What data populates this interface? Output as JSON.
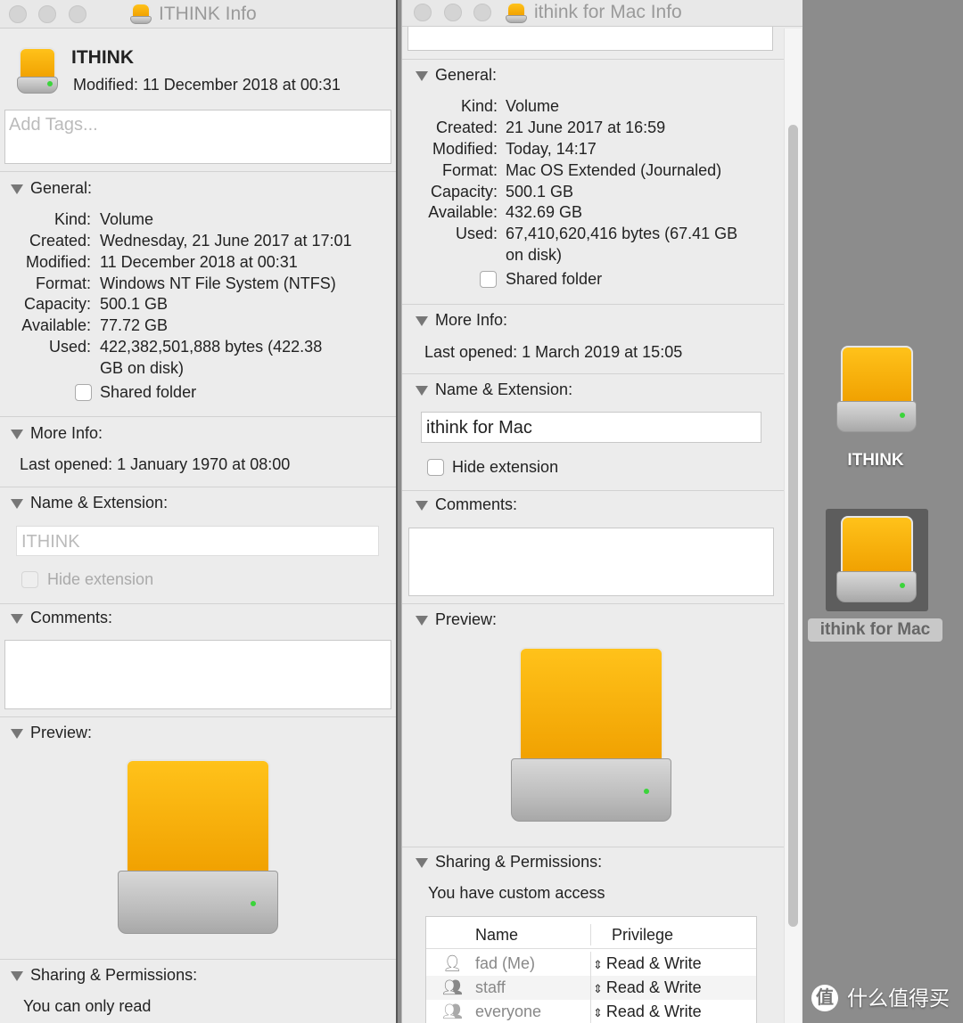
{
  "left": {
    "title": "ITHINK Info",
    "name": "ITHINK",
    "modified": "Modified: 11 December 2018 at 00:31",
    "tags_placeholder": "Add Tags...",
    "general": {
      "heading": "General:",
      "rows": [
        {
          "label": "Kind:",
          "value": "Volume"
        },
        {
          "label": "Created:",
          "value": "Wednesday, 21 June 2017 at 17:01"
        },
        {
          "label": "Modified:",
          "value": "11 December 2018 at 00:31"
        },
        {
          "label": "Format:",
          "value": "Windows NT File System (NTFS)"
        },
        {
          "label": "Capacity:",
          "value": "500.1 GB"
        },
        {
          "label": "Available:",
          "value": "77.72 GB"
        },
        {
          "label": "Used:",
          "value": "422,382,501,888 bytes (422.38",
          "value2": "GB on disk)"
        }
      ],
      "shared_folder": "Shared folder"
    },
    "more_info": {
      "heading": "More Info:",
      "last_opened": "Last opened: 1 January 1970 at 08:00"
    },
    "name_ext": {
      "heading": "Name & Extension:",
      "value": "ITHINK",
      "hide_extension": "Hide extension"
    },
    "comments": {
      "heading": "Comments:"
    },
    "preview": {
      "heading": "Preview:"
    },
    "sharing": {
      "heading": "Sharing & Permissions:",
      "access": "You can only read"
    }
  },
  "right": {
    "title": "ithink for Mac Info",
    "general": {
      "heading": "General:",
      "rows": [
        {
          "label": "Kind:",
          "value": "Volume"
        },
        {
          "label": "Created:",
          "value": "21 June 2017 at 16:59"
        },
        {
          "label": "Modified:",
          "value": "Today, 14:17"
        },
        {
          "label": "Format:",
          "value": "Mac OS Extended (Journaled)"
        },
        {
          "label": "Capacity:",
          "value": "500.1 GB"
        },
        {
          "label": "Available:",
          "value": "432.69 GB"
        },
        {
          "label": "Used:",
          "value": "67,410,620,416 bytes (67.41 GB",
          "value2": "on disk)"
        }
      ],
      "shared_folder": "Shared folder"
    },
    "more_info": {
      "heading": "More Info:",
      "last_opened": "Last opened: 1 March 2019 at 15:05"
    },
    "name_ext": {
      "heading": "Name & Extension:",
      "value": "ithink for Mac",
      "hide_extension": "Hide extension"
    },
    "comments": {
      "heading": "Comments:"
    },
    "preview": {
      "heading": "Preview:"
    },
    "sharing": {
      "heading": "Sharing & Permissions:",
      "access": "You have custom access",
      "columns": [
        "Name",
        "Privilege"
      ],
      "rows": [
        {
          "name": "fad (Me)",
          "privilege": "Read & Write",
          "icon": "user-icon"
        },
        {
          "name": "staff",
          "privilege": "Read & Write",
          "icon": "group-icon"
        },
        {
          "name": "everyone",
          "privilege": "Read & Write",
          "icon": "everyone-icon"
        }
      ]
    }
  },
  "desktop": {
    "items": [
      {
        "label": "ITHINK"
      },
      {
        "label": "ithink for Mac",
        "selected": true
      }
    ]
  },
  "watermark": {
    "badge": "值",
    "text": "什么值得买"
  },
  "colors": {
    "drive_yellow": "#f5ad00",
    "led_green": "#3bd43b",
    "desktop_bg": "#8c8c8c"
  }
}
